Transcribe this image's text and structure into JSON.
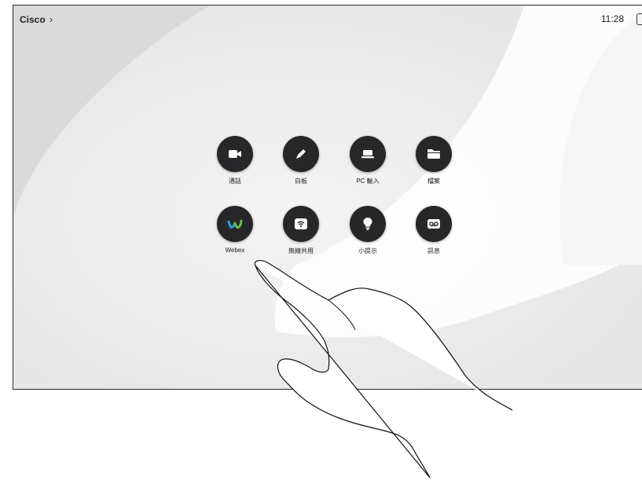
{
  "header": {
    "brand": "Cisco",
    "brand_chevron": "›",
    "time": "11:28"
  },
  "tiles": [
    {
      "label": "通話",
      "icon": "video-camera-icon"
    },
    {
      "label": "白板",
      "icon": "pencil-icon"
    },
    {
      "label": "PC 輸入",
      "icon": "laptop-icon"
    },
    {
      "label": "檔案",
      "icon": "folder-icon"
    },
    {
      "label": "Webex",
      "icon": "webex-logo-icon"
    },
    {
      "label": "無線共用",
      "icon": "wireless-share-icon"
    },
    {
      "label": "小提示",
      "icon": "lightbulb-icon"
    },
    {
      "label": "訊息",
      "icon": "voicemail-icon"
    }
  ],
  "colors": {
    "tile_bg": "#27272a",
    "screen_bg": "#d9d9d9",
    "webex_blue": "#1fa2d8",
    "webex_green": "#6cc04a"
  }
}
